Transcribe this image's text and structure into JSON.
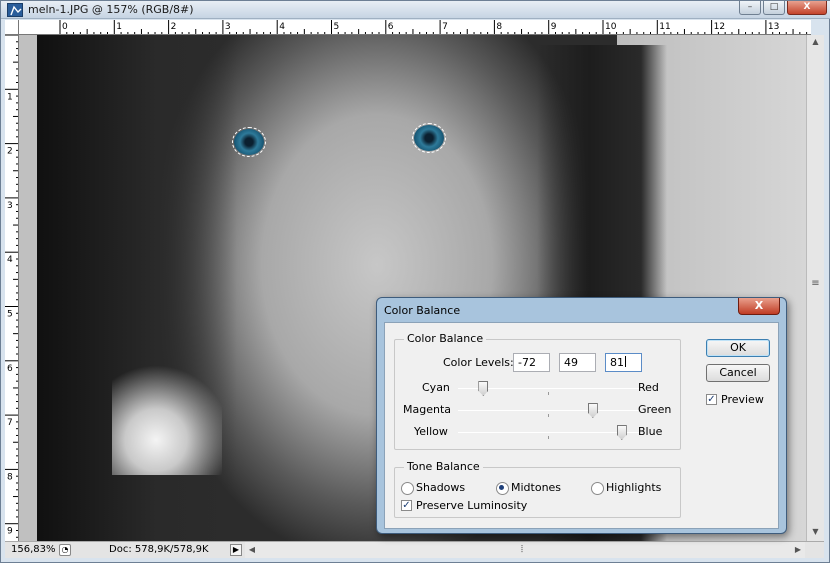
{
  "window": {
    "title": "meln-1.JPG @ 157% (RGB/8#)",
    "controls": {
      "minimize": "–",
      "maximize": "□",
      "close": "X"
    }
  },
  "ruler": {
    "top_labels": [
      "0",
      "1",
      "2",
      "3",
      "4",
      "5",
      "6",
      "7",
      "8",
      "9",
      "10",
      "11",
      "12",
      "13"
    ],
    "left_labels": [
      "1",
      "2",
      "3",
      "4",
      "5",
      "6",
      "7",
      "8",
      "9"
    ]
  },
  "status": {
    "zoom": "156,83%",
    "doc": "Doc: 578,9K/578,9K"
  },
  "dialog": {
    "title": "Color Balance",
    "close_label": "X",
    "color_balance_group": "Color Balance",
    "color_levels_label": "Color Levels:",
    "levels": [
      "-72",
      "49",
      "81"
    ],
    "sliders": [
      {
        "left": "Cyan",
        "right": "Red",
        "value": -72
      },
      {
        "left": "Magenta",
        "right": "Green",
        "value": 49
      },
      {
        "left": "Yellow",
        "right": "Blue",
        "value": 81
      }
    ],
    "tone_group": "Tone Balance",
    "tones": {
      "shadows": "Shadows",
      "midtones": "Midtones",
      "highlights": "Highlights"
    },
    "selected_tone": "Midtones",
    "preserve_luminosity": "Preserve Luminosity",
    "preserve_checked": true,
    "ok": "OK",
    "cancel": "Cancel",
    "preview": "Preview",
    "preview_checked": true
  },
  "colors": {
    "accent": "#3c7fb1",
    "eye_tint": "#2e7a9a"
  }
}
